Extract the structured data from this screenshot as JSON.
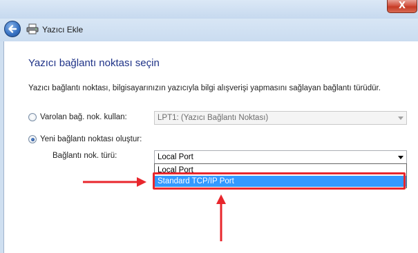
{
  "window": {
    "close_glyph": "X",
    "title": "Yazıcı Ekle"
  },
  "icons": {
    "back": "back-arrow-icon",
    "printer": "printer-icon",
    "close": "close-icon"
  },
  "page": {
    "heading": "Yazıcı bağlantı noktası seçin",
    "description": "Yazıcı bağlantı noktası, bilgisayarınızın yazıcıyla bilgi alışverişi yapmasını sağlayan bağlantı türüdür."
  },
  "existing_port": {
    "label": "Varolan bağ. nok. kullan:",
    "selected": false,
    "combo_value": "LPT1: (Yazıcı Bağlantı Noktası)",
    "enabled": false
  },
  "new_port": {
    "label": "Yeni bağlantı noktası oluştur:",
    "selected": true,
    "type_label": "Bağlantı nok. türü:",
    "combo_value": "Local Port",
    "options": [
      "Local Port",
      "Standard TCP/IP Port"
    ],
    "highlighted_option": "Standard TCP/IP Port"
  },
  "colors": {
    "heading": "#1e3287",
    "selection": "#3399ff",
    "annotation_red": "#e8262c"
  }
}
